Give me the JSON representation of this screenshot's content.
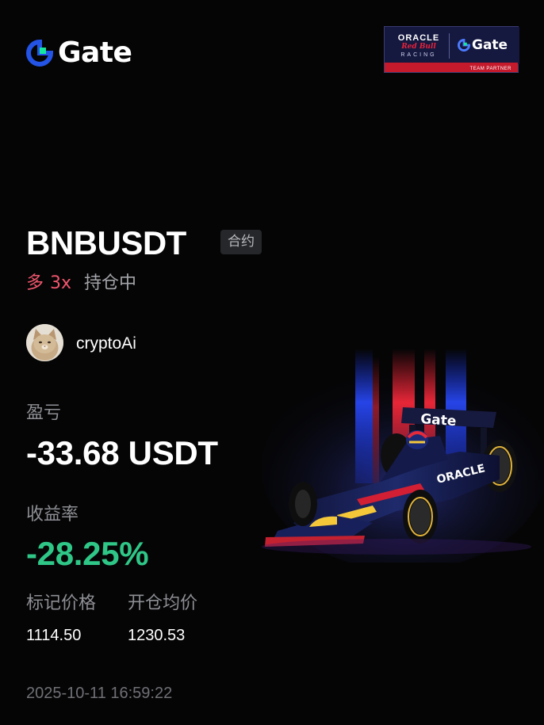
{
  "brand": {
    "logo_text": "Gate",
    "accent_color": "#2354e6",
    "accent_color_2": "#17e6a1"
  },
  "partner": {
    "oracle": "ORACLE",
    "redbull": "Red Bull",
    "racing": "RACING",
    "gate": "Gate",
    "strip": "TEAM PARTNER"
  },
  "position": {
    "pair": "BNBUSDT",
    "tag": "合约",
    "side": "多",
    "leverage": "3x",
    "status": "持仓中",
    "side_color": "#f0566c"
  },
  "user": {
    "name": "cryptoAi"
  },
  "pnl": {
    "label": "盈亏",
    "value": "-33.68 USDT"
  },
  "roi": {
    "label": "收益率",
    "value": "-28.25%",
    "color": "#2fc787"
  },
  "prices": {
    "mark_label": "标记价格",
    "mark_value": "1114.50",
    "entry_label": "开仓均价",
    "entry_value": "1230.53"
  },
  "timestamp": "2025-10-11 16:59:22",
  "car": {
    "wing_text": "Gate",
    "side_text": "ORACLE"
  }
}
